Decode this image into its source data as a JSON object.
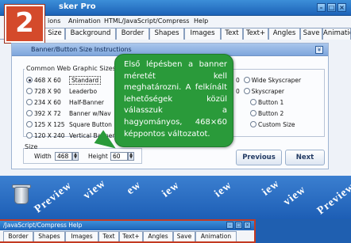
{
  "window": {
    "title": "sker Pro",
    "menu": [
      "ions",
      "Animation",
      "HTML/JavaScript/Compress",
      "Help"
    ],
    "tabs": [
      "Size",
      "Background",
      "Border",
      "Shapes",
      "Images",
      "Text",
      "Text+",
      "Angles",
      "Save",
      "Animation"
    ],
    "active_tab": "Size"
  },
  "step_badge": "2",
  "panel": {
    "header": "Banner/Button Size Instructions",
    "group_label": "Common Web Graphic Sizes",
    "options_left": [
      {
        "size": "468 X 60",
        "name": "Standard",
        "selected": true
      },
      {
        "size": "728 X 90",
        "name": "Leaderbo"
      },
      {
        "size": "234 X 60",
        "name": "Half-Banner"
      },
      {
        "size": "392 X 72",
        "name": "Banner w/Nav"
      },
      {
        "size": "125 X 125",
        "name": "Square Button"
      },
      {
        "size": "120 X 240",
        "name": "Vertical Banner"
      }
    ],
    "options_right": [
      {
        "size": "0",
        "name": "Wide Skyscraper"
      },
      {
        "size": "0",
        "name": "Skyscraper"
      },
      {
        "size": "",
        "name": "Button 1"
      },
      {
        "size": "",
        "name": "Button 2"
      },
      {
        "size": "",
        "name": "Custom Size"
      }
    ],
    "size_group_label": "Size",
    "width_label": "Width",
    "width_value": "468",
    "height_label": "Height",
    "height_value": "60",
    "previous_label": "Previous",
    "next_label": "Next"
  },
  "bubble_text": "Első lépésben a banner méretét kell meghatározni. A felkínált lehetőségek közül válasszuk a hagyományos, 468×60 képpontos változatot.",
  "preview_watermark": [
    "Preview",
    "view",
    "ew",
    "iew",
    "iew",
    "iew",
    "view",
    "Preview"
  ],
  "window2": {
    "menu": "/JavaScript/Compress   Help",
    "tabs": [
      "Border",
      "Shapes",
      "Images",
      "Text",
      "Text+",
      "Angles",
      "Save",
      "Animation"
    ]
  },
  "colors": {
    "titlebar": "#1d63b8",
    "bubble": "#2a9a3a",
    "badge": "#d44a2b",
    "band": "#1d5eb5"
  }
}
